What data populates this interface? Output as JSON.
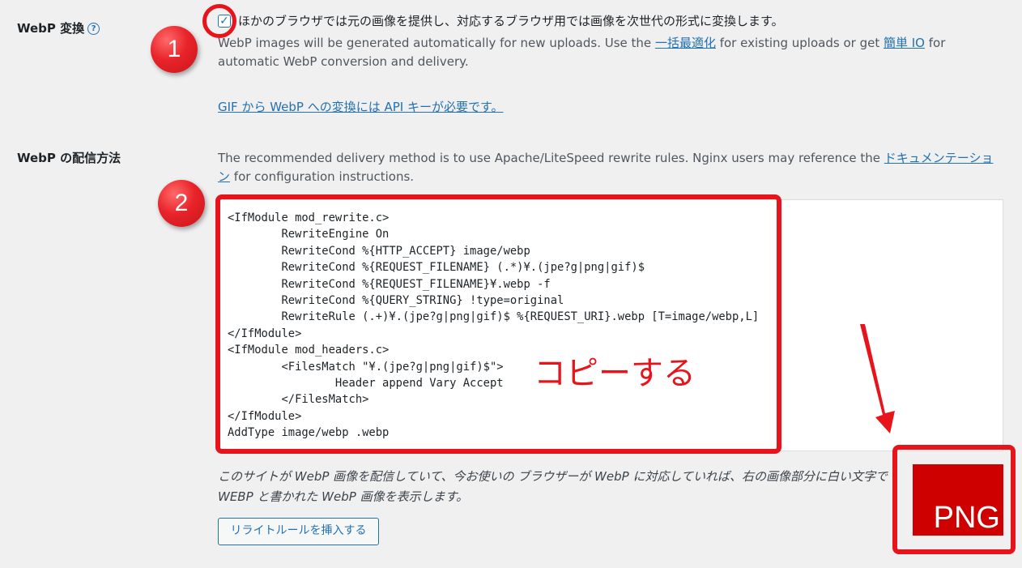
{
  "webp_convert": {
    "label": "WebP 変換",
    "help_icon": "question-circle-icon",
    "checkbox_checked": true,
    "checkbox_label": "ほかのブラウザでは元の画像を提供し、対応するブラウザ用では画像を次世代の形式に変換します。",
    "desc_before": "WebP images will be generated automatically for new uploads. Use the ",
    "bulk_link": "一括最適化",
    "desc_middle": " for existing uploads or get ",
    "io_link": "簡単 IO",
    "desc_after": " for automatic WebP conversion and delivery.",
    "gif_link": "GIF から WebP への変換には API キーが必要です。"
  },
  "webp_delivery": {
    "label": "WebP の配信方法",
    "desc_before": "The recommended delivery method is to use Apache/LiteSpeed rewrite rules. Nginx users may reference the ",
    "doc_link": "ドキュメンテーション",
    "desc_after": " for configuration instructions.",
    "code_lines": [
      "<IfModule mod_rewrite.c>",
      "        RewriteEngine On",
      "        RewriteCond %{HTTP_ACCEPT} image/webp",
      "        RewriteCond %{REQUEST_FILENAME} (.*)¥.(jpe?g|png|gif)$",
      "        RewriteCond %{REQUEST_FILENAME}¥.webp -f",
      "        RewriteCond %{QUERY_STRING} !type=original",
      "        RewriteRule (.+)¥.(jpe?g|png|gif)$ %{REQUEST_URI}.webp [T=image/webp,L]",
      "</IfModule>",
      "<IfModule mod_headers.c>",
      "        <FilesMatch \"¥.(jpe?g|png|gif)$\">",
      "                Header append Vary Accept",
      "        </FilesMatch>",
      "</IfModule>",
      "AddType image/webp .webp"
    ],
    "note": "このサイトが WebP 画像を配信していて、今お使いの ブラウザーが WebP に対応していれば、右の画像部分に白い文字で WEBP と書かれた WebP 画像を表示します。",
    "insert_button": "リライトルールを挿入する",
    "preview_text": "PNG"
  },
  "annotations": {
    "step1": "1",
    "step2": "2",
    "copy_label": "コピーする",
    "color": "#e8141c"
  }
}
